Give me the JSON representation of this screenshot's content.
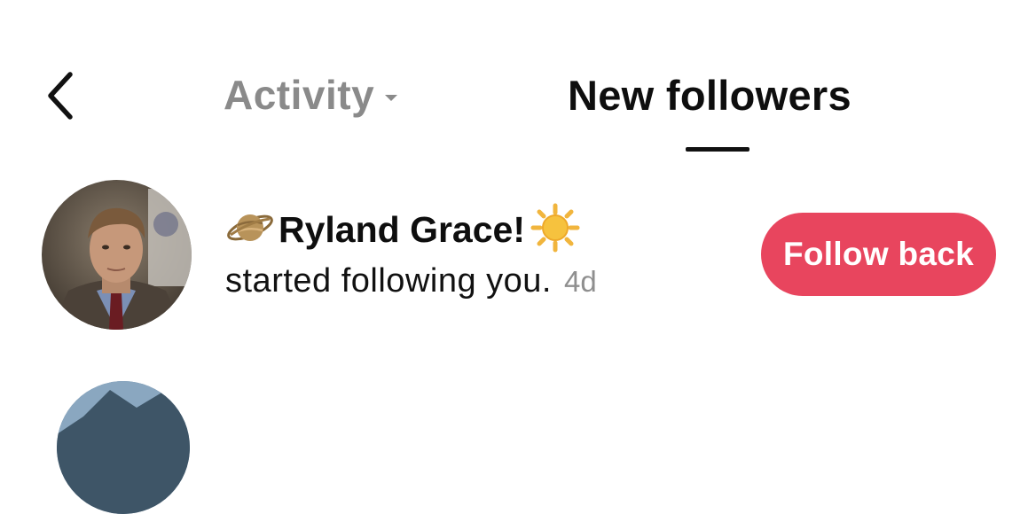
{
  "header": {
    "back_icon": "chevron-left-icon",
    "tabs": [
      {
        "label": "Activity",
        "has_dropdown": true,
        "active": false
      },
      {
        "label": "New followers",
        "active": true
      }
    ]
  },
  "notifications": [
    {
      "avatar_icon": "user-avatar-photo",
      "name_prefix_emoji": "🪐",
      "name": "Ryland Grace!",
      "name_suffix_emoji": "☀️",
      "message": "started following you.",
      "time": "4d",
      "action_label": "Follow back"
    }
  ],
  "colors": {
    "accent": "#e8455e",
    "inactive_tab": "#8a8a8a",
    "timestamp": "#8f8f8f"
  }
}
